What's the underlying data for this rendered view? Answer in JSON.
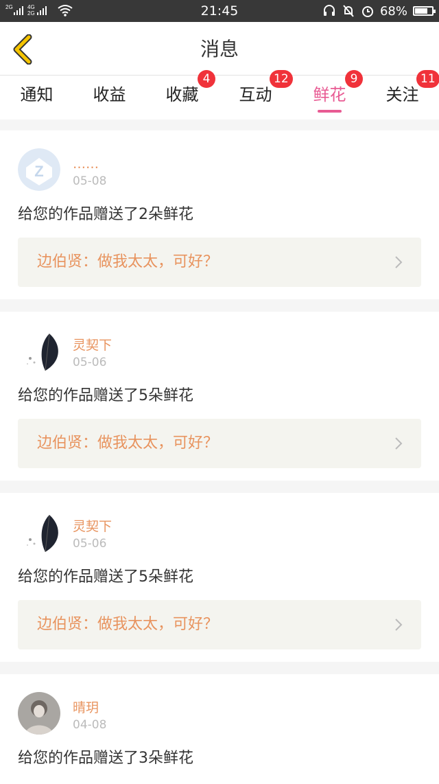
{
  "status_bar": {
    "signal_left": "2G",
    "signal_right": "4G/2G",
    "time": "21:45",
    "battery": "68%",
    "icons": [
      "signal-icon",
      "wifi-icon",
      "headset-icon",
      "mute-bell-icon",
      "alarm-icon",
      "battery-icon"
    ]
  },
  "header": {
    "title": "消息",
    "back_icon": "back-chevron-icon"
  },
  "tabs": [
    {
      "label": "通知",
      "badge": ""
    },
    {
      "label": "收益",
      "badge": ""
    },
    {
      "label": "收藏",
      "badge": "4"
    },
    {
      "label": "互动",
      "badge": "12"
    },
    {
      "label": "鲜花",
      "badge": "9",
      "active": true
    },
    {
      "label": "关注",
      "badge": "11"
    }
  ],
  "messages": [
    {
      "name": "……",
      "date": "05-08",
      "text": "给您的作品赠送了2朵鲜花",
      "work_title": "边伯贤：做我太太，可好？",
      "avatar": "default-avatar-icon"
    },
    {
      "name": "灵契下",
      "date": "05-06",
      "text": "给您的作品赠送了5朵鲜花",
      "work_title": "边伯贤：做我太太，可好？",
      "avatar": "feather-avatar"
    },
    {
      "name": "灵契下",
      "date": "05-06",
      "text": "给您的作品赠送了5朵鲜花",
      "work_title": "边伯贤：做我太太，可好？",
      "avatar": "feather-avatar"
    },
    {
      "name": "晴玥",
      "date": "04-08",
      "text": "给您的作品赠送了3朵鲜花",
      "work_title": "",
      "avatar": "photo-avatar"
    }
  ],
  "colors": {
    "accent_pink": "#e85b93",
    "badge_red": "#f0323a",
    "name_orange": "#e8935e",
    "back_yellow": "#f5c400"
  }
}
